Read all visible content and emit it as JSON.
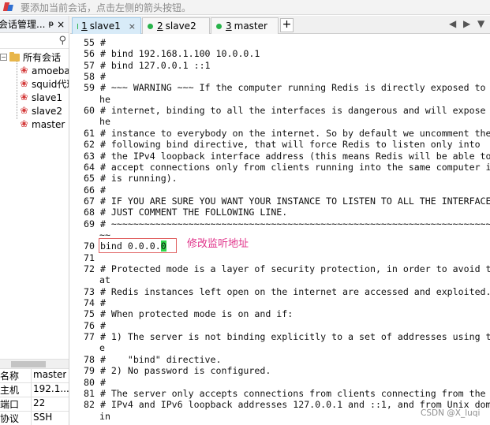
{
  "hint_bar": {
    "text": "要添加当前会话，点击左侧的箭头按钮。"
  },
  "session_panel": {
    "title": "会话管理...",
    "pin": "ᵽ",
    "close": "×",
    "root_label": "所有会话",
    "sessions": [
      "amoeba",
      "squid代理",
      "slave1",
      "slave2",
      "master"
    ],
    "selected": "master"
  },
  "properties": [
    {
      "key": "名称",
      "value": "master"
    },
    {
      "key": "主机",
      "value": "192.1..."
    },
    {
      "key": "端口",
      "value": "22"
    },
    {
      "key": "协议",
      "value": "SSH"
    }
  ],
  "tabs": [
    {
      "num": "1",
      "name": "slave1",
      "active": true
    },
    {
      "num": "2",
      "name": "slave2",
      "active": false
    },
    {
      "num": "3",
      "name": "master",
      "active": false
    }
  ],
  "terminal": {
    "lines": [
      "55 #",
      "56 # bind 192.168.1.100 10.0.0.1",
      "57 # bind 127.0.0.1 ::1",
      "58 #",
      "59 # ~~~ WARNING ~~~ If the computer running Redis is directly exposed to t",
      "he",
      "60 # internet, binding to all the interfaces is dangerous and will expose t",
      "he",
      "61 # instance to everybody on the internet. So by default we uncomment the",
      "62 # following bind directive, that will force Redis to listen only into",
      "63 # the IPv4 loopback interface address (this means Redis will be able to",
      "64 # accept connections only from clients running into the same computer it",
      "65 # is running).",
      "66 #",
      "67 # IF YOU ARE SURE YOU WANT YOUR INSTANCE TO LISTEN TO ALL THE INTERFACES",
      "68 # JUST COMMENT THE FOLLOWING LINE.",
      "69 # ~~~~~~~~~~~~~~~~~~~~~~~~~~~~~~~~~~~~~~~~~~~~~~~~~~~~~~~~~~~~~~~~~~~~~~~~",
      "~~",
      "70 bind 0.0.0.0",
      "71",
      "72 # Protected mode is a layer of security protection, in order to avoid th",
      "at",
      "73 # Redis instances left open on the internet are accessed and exploited.",
      "74 #",
      "75 # When protected mode is on and if:",
      "76 #",
      "77 # 1) The server is not binding explicitly to a set of addresses using th",
      "e",
      "78 #    \"bind\" directive.",
      "79 # 2) No password is configured.",
      "80 #",
      "81 # The server only accepts connections from clients connecting from the",
      "82 # IPv4 and IPv6 loopback addresses 127.0.0.1 and ::1, and from Unix doma",
      "in"
    ],
    "annotation": "修改监听地址",
    "watermark": "CSDN @X_luqi"
  },
  "colors": {
    "active_tab": "#d8ebf8",
    "connected_dot": "#27b34a",
    "annotation": "#e0338a",
    "highlight_box": "#e06060",
    "cursor": "#2fd84a"
  }
}
